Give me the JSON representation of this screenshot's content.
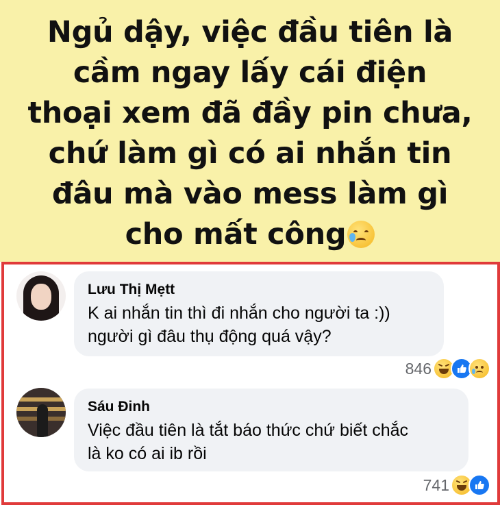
{
  "post": {
    "lines": [
      "Ngủ dậy, việc đầu tiên là",
      "cầm ngay lấy cái điện",
      "thoại xem đã đầy pin chưa,",
      "chứ làm gì có ai nhắn tin",
      "đâu mà vào mess làm gì",
      "cho mất công"
    ],
    "emoji": "crying-face-emoji",
    "background_color": "#f9f1a9"
  },
  "highlight_border_color": "#e03a3a",
  "comments": [
    {
      "author": "Lưu Thị Mẹtt",
      "text_lines": [
        "K ai nhắn tin thì đi nhắn cho người ta :))",
        "người gì đâu thụ động quá vậy?"
      ],
      "reaction_count": "846",
      "reactions": [
        "haha",
        "like",
        "sad"
      ]
    },
    {
      "author": "Sáu Đinh",
      "text_lines": [
        "Việc đầu tiên là tắt báo thức chứ biết chắc",
        "là ko có ai ib rồi"
      ],
      "reaction_count": "741",
      "reactions": [
        "haha",
        "like"
      ]
    }
  ]
}
